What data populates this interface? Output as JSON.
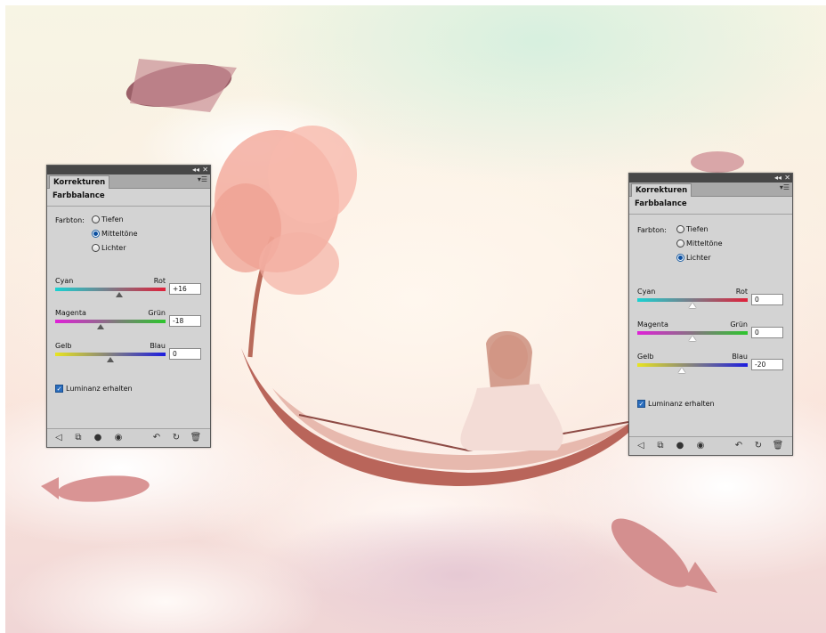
{
  "panels": [
    {
      "tab_label": "Korrekturen",
      "title": "Farbbalance",
      "tone_label": "Farbton:",
      "tones": [
        {
          "label": "Tiefen",
          "selected": false
        },
        {
          "label": "Mitteltöne",
          "selected": true
        },
        {
          "label": "Lichter",
          "selected": false
        }
      ],
      "sliders": [
        {
          "left": "Cyan",
          "right": "Rot",
          "value": "+16",
          "level": 16
        },
        {
          "left": "Magenta",
          "right": "Grün",
          "value": "-18",
          "level": -18
        },
        {
          "left": "Gelb",
          "right": "Blau",
          "value": "0",
          "level": 0
        }
      ],
      "checkbox_label": "Luminanz erhalten",
      "checkbox_checked": true
    },
    {
      "tab_label": "Korrekturen",
      "title": "Farbbalance",
      "tone_label": "Farbton:",
      "tones": [
        {
          "label": "Tiefen",
          "selected": false
        },
        {
          "label": "Mitteltöne",
          "selected": false
        },
        {
          "label": "Lichter",
          "selected": true
        }
      ],
      "sliders": [
        {
          "left": "Cyan",
          "right": "Rot",
          "value": "0",
          "level": 0
        },
        {
          "left": "Magenta",
          "right": "Grün",
          "value": "0",
          "level": 0
        },
        {
          "left": "Gelb",
          "right": "Blau",
          "value": "-20",
          "level": -20
        }
      ],
      "checkbox_label": "Luminanz erhalten",
      "checkbox_checked": true
    }
  ],
  "panel_controls": {
    "collapse": "◂◂",
    "close": "✕",
    "menu": "▾☰"
  },
  "footer_icons": [
    "back-arrow-icon",
    "clip-layer-icon",
    "visibility-toggle-icon",
    "eye-icon",
    "previous-state-icon",
    "reset-icon",
    "trash-icon"
  ],
  "colors": {
    "cyan_red": [
      "#19d2d2",
      "#e0203a"
    ],
    "magenta_green": [
      "#e020d8",
      "#2cc62c"
    ],
    "yellow_blue": [
      "#e8e420",
      "#1c1ce0"
    ],
    "accent": "#0b4fa0"
  }
}
